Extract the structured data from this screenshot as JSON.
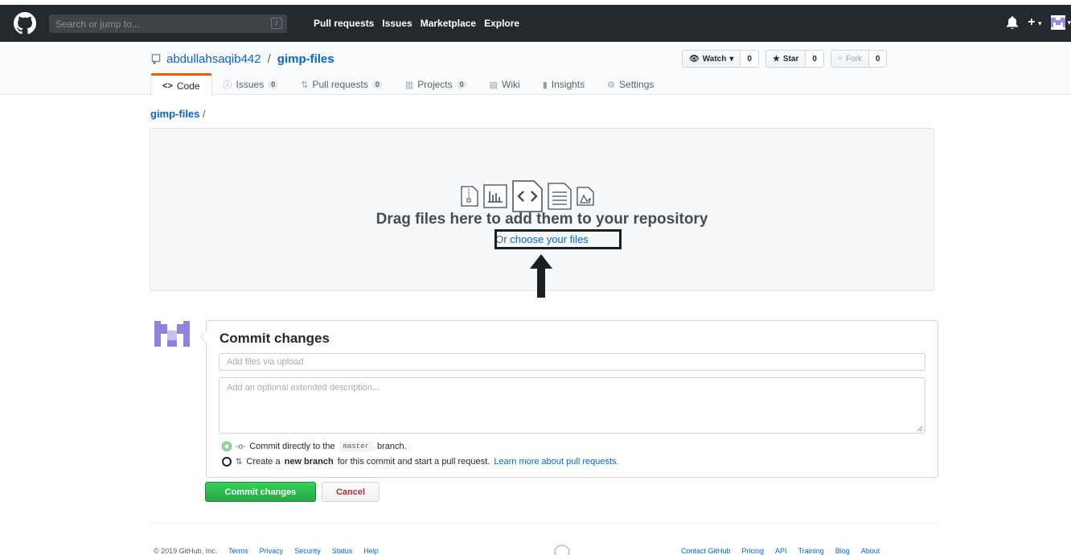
{
  "header": {
    "search_placeholder": "Search or jump to...",
    "search_key": "/",
    "nav": [
      "Pull requests",
      "Issues",
      "Marketplace",
      "Explore"
    ],
    "plus": "+"
  },
  "repo": {
    "owner": "abdullahsaqib442",
    "separator": "/",
    "name": "gimp-files",
    "watch_label": "Watch",
    "watch_count": "0",
    "star_label": "Star",
    "star_count": "0",
    "fork_label": "Fork",
    "fork_count": "0"
  },
  "tabs": [
    {
      "icon": "<>",
      "label": "Code",
      "counter": ""
    },
    {
      "icon": "ⓘ",
      "label": "Issues",
      "counter": "0"
    },
    {
      "icon": "⇅",
      "label": "Pull requests",
      "counter": "0"
    },
    {
      "icon": "▥",
      "label": "Projects",
      "counter": "0"
    },
    {
      "icon": "▤",
      "label": "Wiki",
      "counter": ""
    },
    {
      "icon": "▮",
      "label": "Insights",
      "counter": ""
    },
    {
      "icon": "⚙",
      "label": "Settings",
      "counter": ""
    }
  ],
  "breadcrumb": {
    "repo": "gimp-files",
    "slash": "/"
  },
  "dropzone": {
    "title": "Drag files here to add them to your repository",
    "prefix": "Or",
    "link": "choose your files"
  },
  "commit": {
    "title": "Commit changes",
    "summary_placeholder": "Add files via upload",
    "description_placeholder": "Add an optional extended description...",
    "option1_prefix": "Commit directly to the",
    "branch": "master",
    "option1_suffix": "branch.",
    "option2_prefix": "Create a",
    "option2_bold": "new branch",
    "option2_middle": "for this commit and start a pull request.",
    "option2_link": "Learn more about pull requests.",
    "submit": "Commit changes",
    "cancel": "Cancel"
  },
  "footer": {
    "copyright": "© 2019 GitHub, Inc.",
    "left_links": [
      "Terms",
      "Privacy",
      "Security",
      "Status",
      "Help"
    ],
    "right_links": [
      "Contact GitHub",
      "Pricing",
      "API",
      "Training",
      "Blog",
      "About"
    ]
  },
  "colors": {
    "header_bg": "#24292e",
    "link": "#0366d6",
    "tab_accent": "#e36209",
    "commit_green": "#28a745",
    "cancel_red": "#cb2431"
  }
}
